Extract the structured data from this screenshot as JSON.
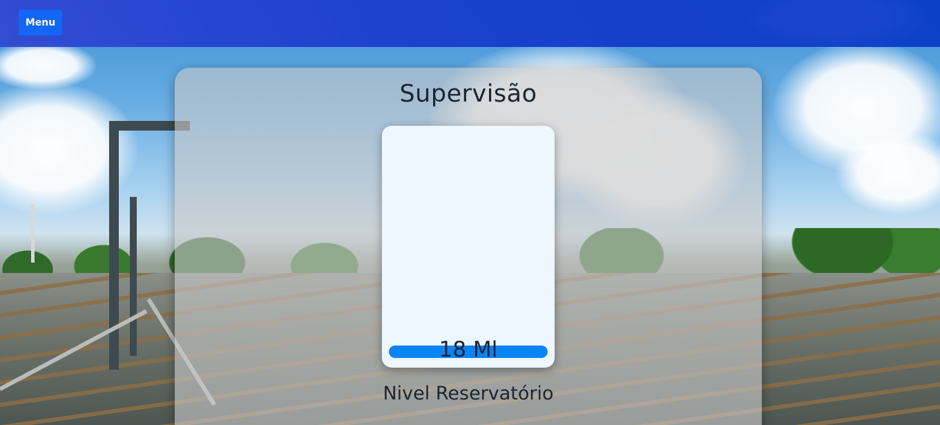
{
  "header": {
    "menu_label": "Menu"
  },
  "panel": {
    "title": "Supervisão",
    "label": "Nivel Reservatório"
  },
  "gauge": {
    "value_text": "18 Ml",
    "fill_fraction": 1.0
  },
  "colors": {
    "header_bg": "#1e3fd0",
    "menu_button": "#1466f5",
    "gauge_fill": "#0a84f5",
    "gauge_card": "#eef6fe"
  }
}
